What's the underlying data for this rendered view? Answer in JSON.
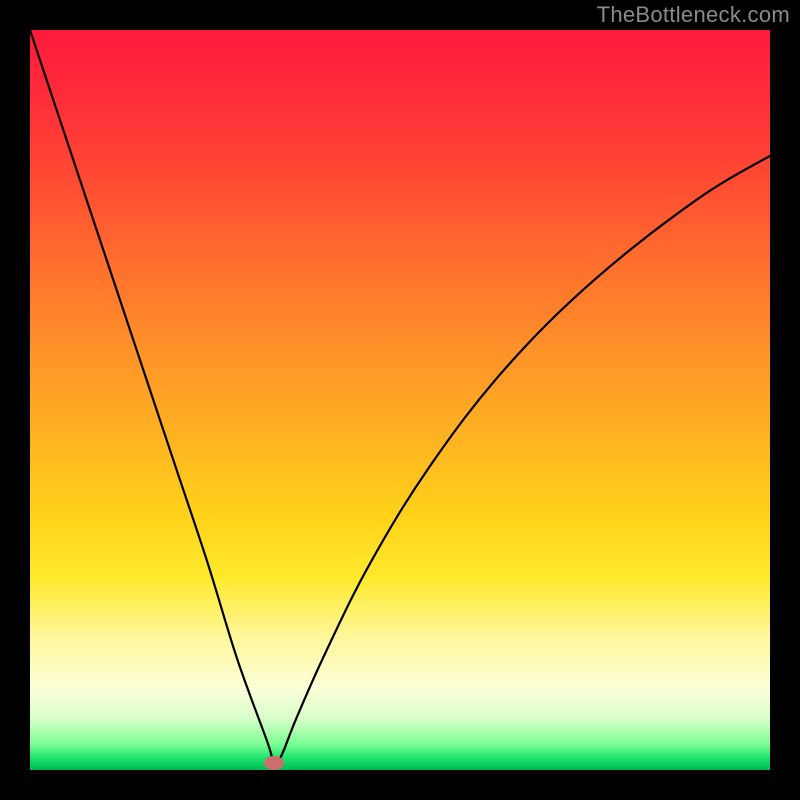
{
  "watermark": "TheBottleneck.com",
  "chart_data": {
    "type": "line",
    "title": "",
    "xlabel": "",
    "ylabel": "",
    "xlim": [
      0,
      100
    ],
    "ylim": [
      0,
      100
    ],
    "grid": false,
    "legend": false,
    "background_gradient": {
      "stops": [
        {
          "pos": 0,
          "color": "#ff1a3c"
        },
        {
          "pos": 18,
          "color": "#ff4433"
        },
        {
          "pos": 42,
          "color": "#ff8e2a"
        },
        {
          "pos": 66,
          "color": "#ffd31a"
        },
        {
          "pos": 82,
          "color": "#fff79a"
        },
        {
          "pos": 93,
          "color": "#d9ffca"
        },
        {
          "pos": 100,
          "color": "#00b851"
        }
      ]
    },
    "series": [
      {
        "name": "curve",
        "x": [
          0,
          4,
          8,
          12,
          16,
          20,
          24,
          28,
          32,
          33,
          34,
          36,
          40,
          46,
          54,
          64,
          76,
          90,
          100
        ],
        "y": [
          100,
          88,
          76,
          64,
          52,
          40,
          28,
          15,
          4,
          1,
          2,
          7,
          16,
          28,
          41,
          54,
          66,
          77,
          83
        ]
      }
    ],
    "marker": {
      "x": 33,
      "y": 1,
      "color": "#cc6e6e"
    },
    "vertex": {
      "x": 33,
      "y": 0
    }
  }
}
